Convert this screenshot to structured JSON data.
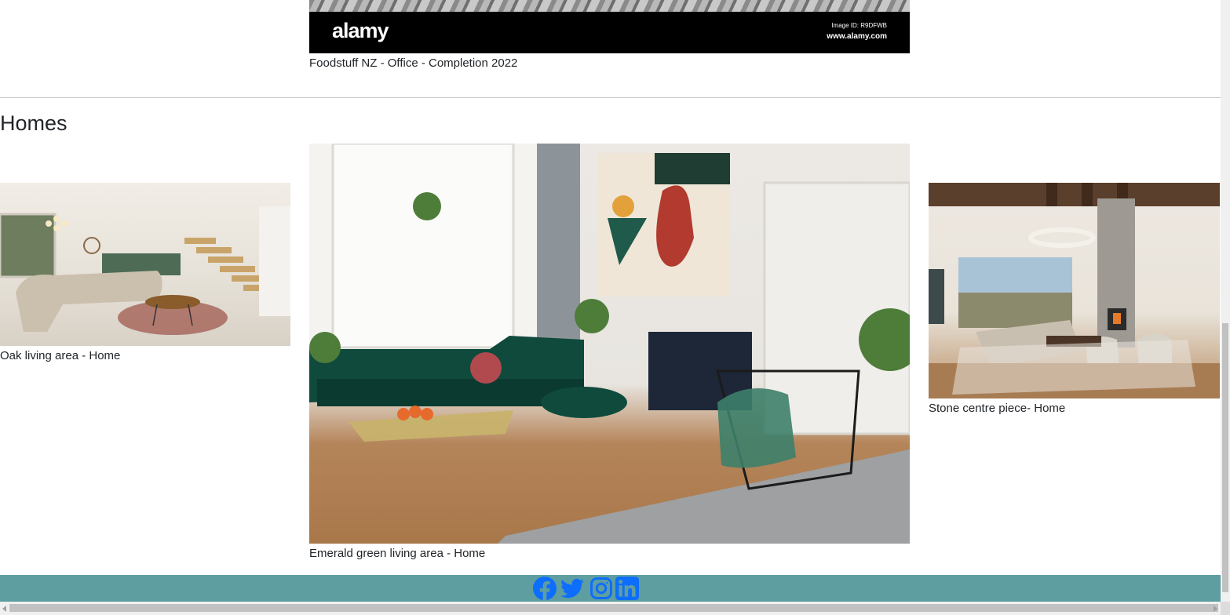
{
  "top_image": {
    "logo": "alamy",
    "image_id": "Image ID: R9DFWB",
    "url": "www.alamy.com",
    "caption": "Foodstuff NZ - Office - Completion 2022"
  },
  "homes": {
    "title": "Homes",
    "items": [
      {
        "caption": "Oak living area - Home"
      },
      {
        "caption": "Emerald green living area - Home"
      },
      {
        "caption": "Stone centre piece- Home"
      }
    ]
  },
  "footer": {
    "icons": [
      "facebook-icon",
      "twitter-icon",
      "instagram-icon",
      "linkedin-icon"
    ],
    "icon_color": "#0d6efd",
    "background": "#5f9ea0"
  }
}
